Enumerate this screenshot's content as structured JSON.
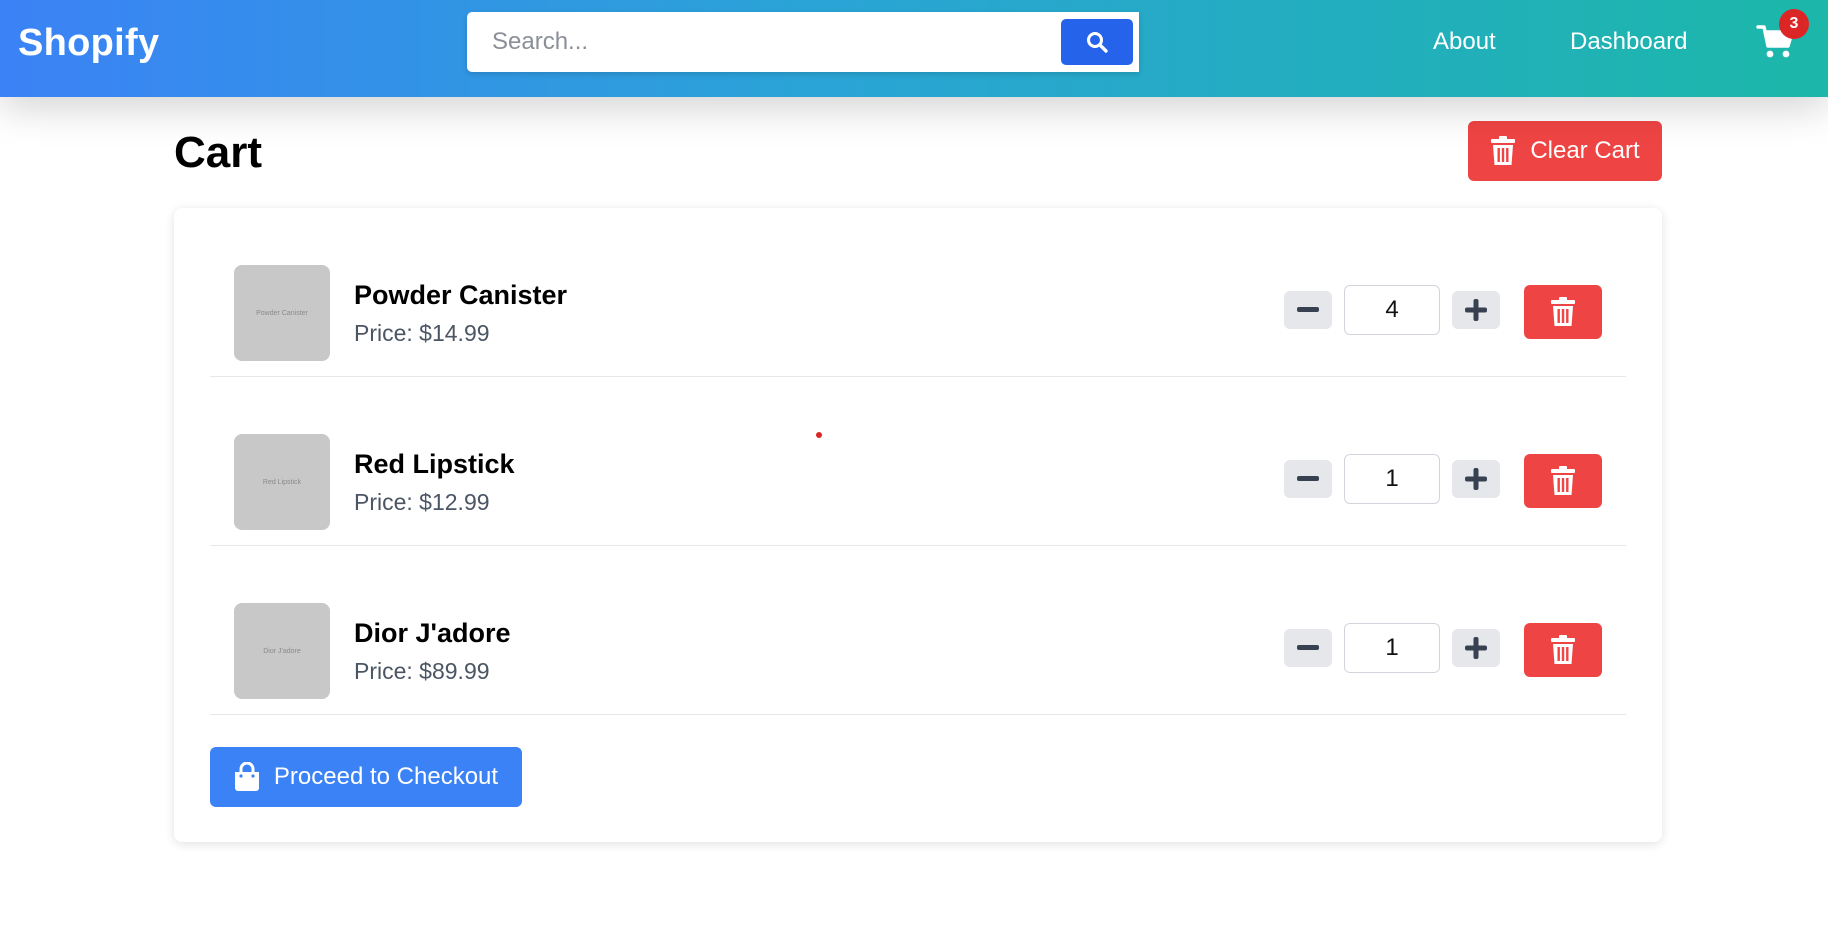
{
  "header": {
    "logo": "Shopify",
    "search": {
      "placeholder": "Search...",
      "value": ""
    },
    "nav": [
      {
        "label": "About"
      },
      {
        "label": "Dashboard"
      }
    ],
    "cart_count": "3"
  },
  "page": {
    "title": "Cart",
    "clear_label": "Clear Cart"
  },
  "cart": {
    "items": [
      {
        "name": "Powder Canister",
        "price": "Price: $14.99",
        "thumb_alt": "Powder Canister",
        "qty": "4"
      },
      {
        "name": "Red Lipstick",
        "price": "Price: $12.99",
        "thumb_alt": "Red Lipstick",
        "qty": "1"
      },
      {
        "name": "Dior J'adore",
        "price": "Price: $89.99",
        "thumb_alt": "Dior J'adore",
        "qty": "1"
      }
    ],
    "checkout_label": "Proceed to Checkout"
  },
  "colors": {
    "header_start": "#3b82f6",
    "header_end": "#1cb7a9",
    "danger": "#ef4444",
    "primary": "#3b82f6",
    "search_button": "#2563eb",
    "badge": "#dc2626"
  },
  "icons": [
    "search-icon",
    "cart-icon",
    "trash-icon",
    "minus-icon",
    "plus-icon",
    "shopping-bag-icon"
  ]
}
